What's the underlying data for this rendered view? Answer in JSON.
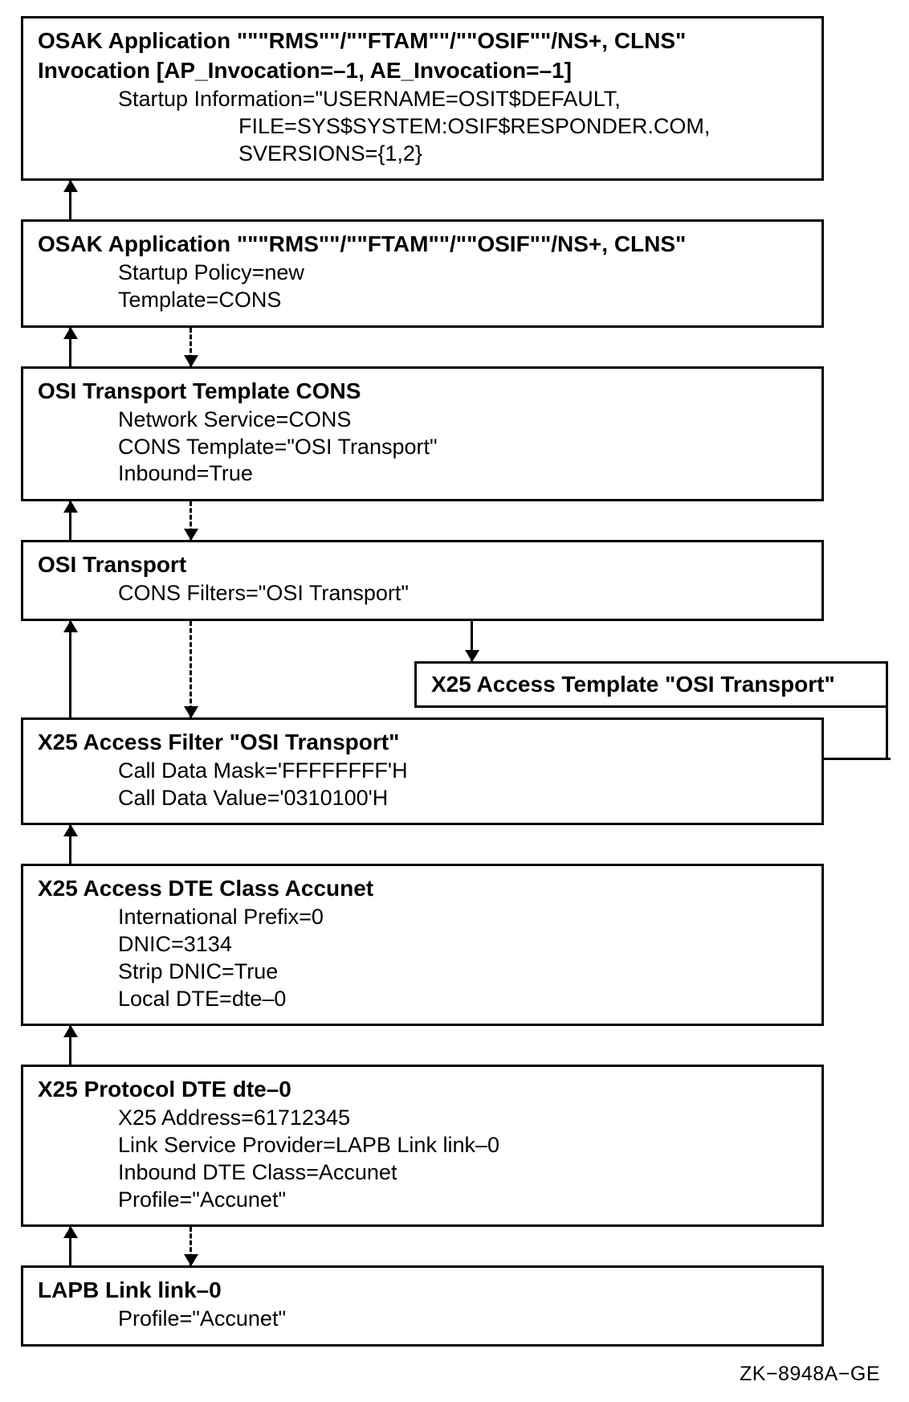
{
  "boxes": {
    "b1": {
      "title": "OSAK Application \"\"\"RMS\"\"/\"\"FTAM\"\"/\"\"OSIF\"\"/NS+, CLNS\"",
      "sub": "Invocation [AP_Invocation=–1, AE_Invocation=–1]",
      "attr1": "Startup Information=\"USERNAME=OSIT$DEFAULT,",
      "attr2": "                    FILE=SYS$SYSTEM:OSIF$RESPONDER.COM,",
      "attr3": "                    SVERSIONS={1,2}"
    },
    "b2": {
      "title": "OSAK Application \"\"\"RMS\"\"/\"\"FTAM\"\"/\"\"OSIF\"\"/NS+, CLNS\"",
      "attr1": "Startup Policy=new",
      "attr2": "Template=CONS"
    },
    "b3": {
      "title": "OSI Transport Template CONS",
      "attr1": "Network Service=CONS",
      "attr2": "CONS Template=\"OSI Transport\"",
      "attr3": "Inbound=True"
    },
    "b4": {
      "title": "OSI Transport",
      "attr1": "CONS Filters=\"OSI Transport\""
    },
    "side": {
      "title": "X25 Access Template \"OSI Transport\""
    },
    "b5": {
      "title": "X25 Access Filter \"OSI Transport\"",
      "attr1": "Call Data Mask='FFFFFFFF'H",
      "attr2": "Call Data Value='0310100'H"
    },
    "b6": {
      "title": "X25 Access DTE Class Accunet",
      "attr1": "International Prefix=0",
      "attr2": "DNIC=3134",
      "attr3": "Strip DNIC=True",
      "attr4": "Local DTE=dte–0"
    },
    "b7": {
      "title": "X25 Protocol DTE dte–0",
      "attr1": "X25 Address=61712345",
      "attr2": "Link Service Provider=LAPB Link link–0",
      "attr3": "Inbound DTE Class=Accunet",
      "attr4": "Profile=\"Accunet\""
    },
    "b8": {
      "title": "LAPB Link link–0",
      "attr1": "Profile=\"Accunet\""
    }
  },
  "footer": "ZK−8948A−GE"
}
